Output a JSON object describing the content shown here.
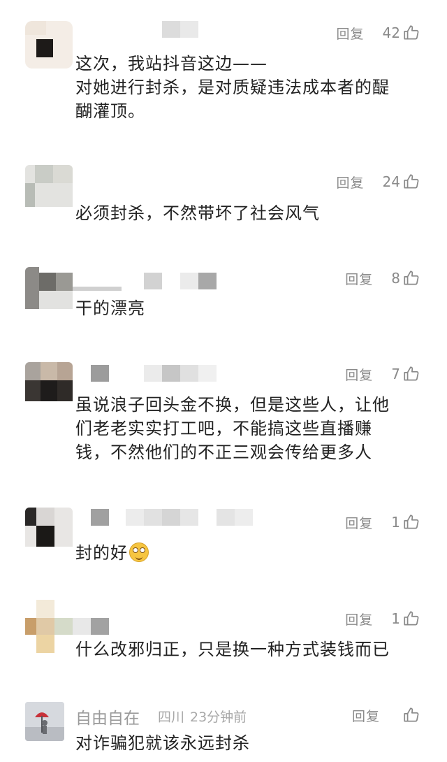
{
  "icons": {
    "like": "thumbs-up-icon",
    "emoji": "smiling-face-emoji"
  },
  "colors": {
    "text": "#222222",
    "secondary": "#8a8a8a",
    "background": "#ffffff"
  },
  "comments": [
    {
      "reply_label": "回复",
      "likes": "42",
      "lines": [
        "这次，我站抖音这边——",
        "对她进行封杀，是对质疑违法成本者的醍",
        "醐灌顶。"
      ]
    },
    {
      "reply_label": "回复",
      "likes": "24",
      "lines": [
        "必须封杀，不然带坏了社会风气"
      ]
    },
    {
      "reply_label": "回复",
      "likes": "8",
      "lines": [
        "干的漂亮"
      ]
    },
    {
      "reply_label": "回复",
      "likes": "7",
      "lines": [
        "虽说浪子回头金不换，但是这些人，让他",
        "们老老实实打工吧，不能搞这些直播赚",
        "钱，不然他们的不正三观会传给更多人"
      ]
    },
    {
      "reply_label": "回复",
      "likes": "1",
      "text": "封的好"
    },
    {
      "reply_label": "回复",
      "likes": "1",
      "lines": [
        "什么改邪归正，只是换一种方式装钱而已"
      ]
    },
    {
      "reply_label": "回复",
      "author": "自由自在",
      "location": "四川",
      "time": "23分钟前",
      "lines": [
        "对诈骗犯就该永远封杀"
      ]
    }
  ]
}
